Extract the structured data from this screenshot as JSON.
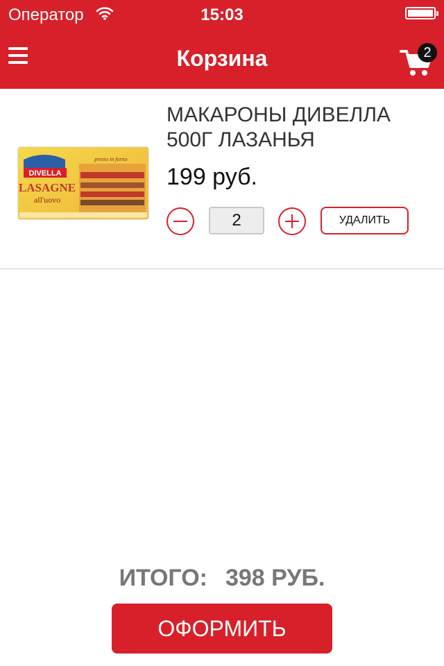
{
  "status_bar": {
    "carrier": "Оператор",
    "time": "15:03"
  },
  "header": {
    "title": "Корзина",
    "cart_count": "2",
    "menu_icon": "hamburger-icon",
    "cart_icon": "shopping-cart-icon"
  },
  "cart": {
    "items": [
      {
        "name": "МАКАРОНЫ ДИВЕЛЛА 500Г ЛАЗАНЬЯ",
        "price": "199 руб.",
        "quantity": "2",
        "delete_label": "УДАЛИТЬ",
        "image": {
          "brand": "DIVELLA",
          "product": "LASAGNE",
          "subtitle": "all'uovo",
          "tag": "presto in forno"
        }
      }
    ]
  },
  "footer": {
    "total_label": "ИТОГО:",
    "total_value": "398 РУБ.",
    "checkout_label": "ОФОРМИТЬ"
  },
  "colors": {
    "accent": "#d8202a",
    "total_text": "#777777"
  }
}
